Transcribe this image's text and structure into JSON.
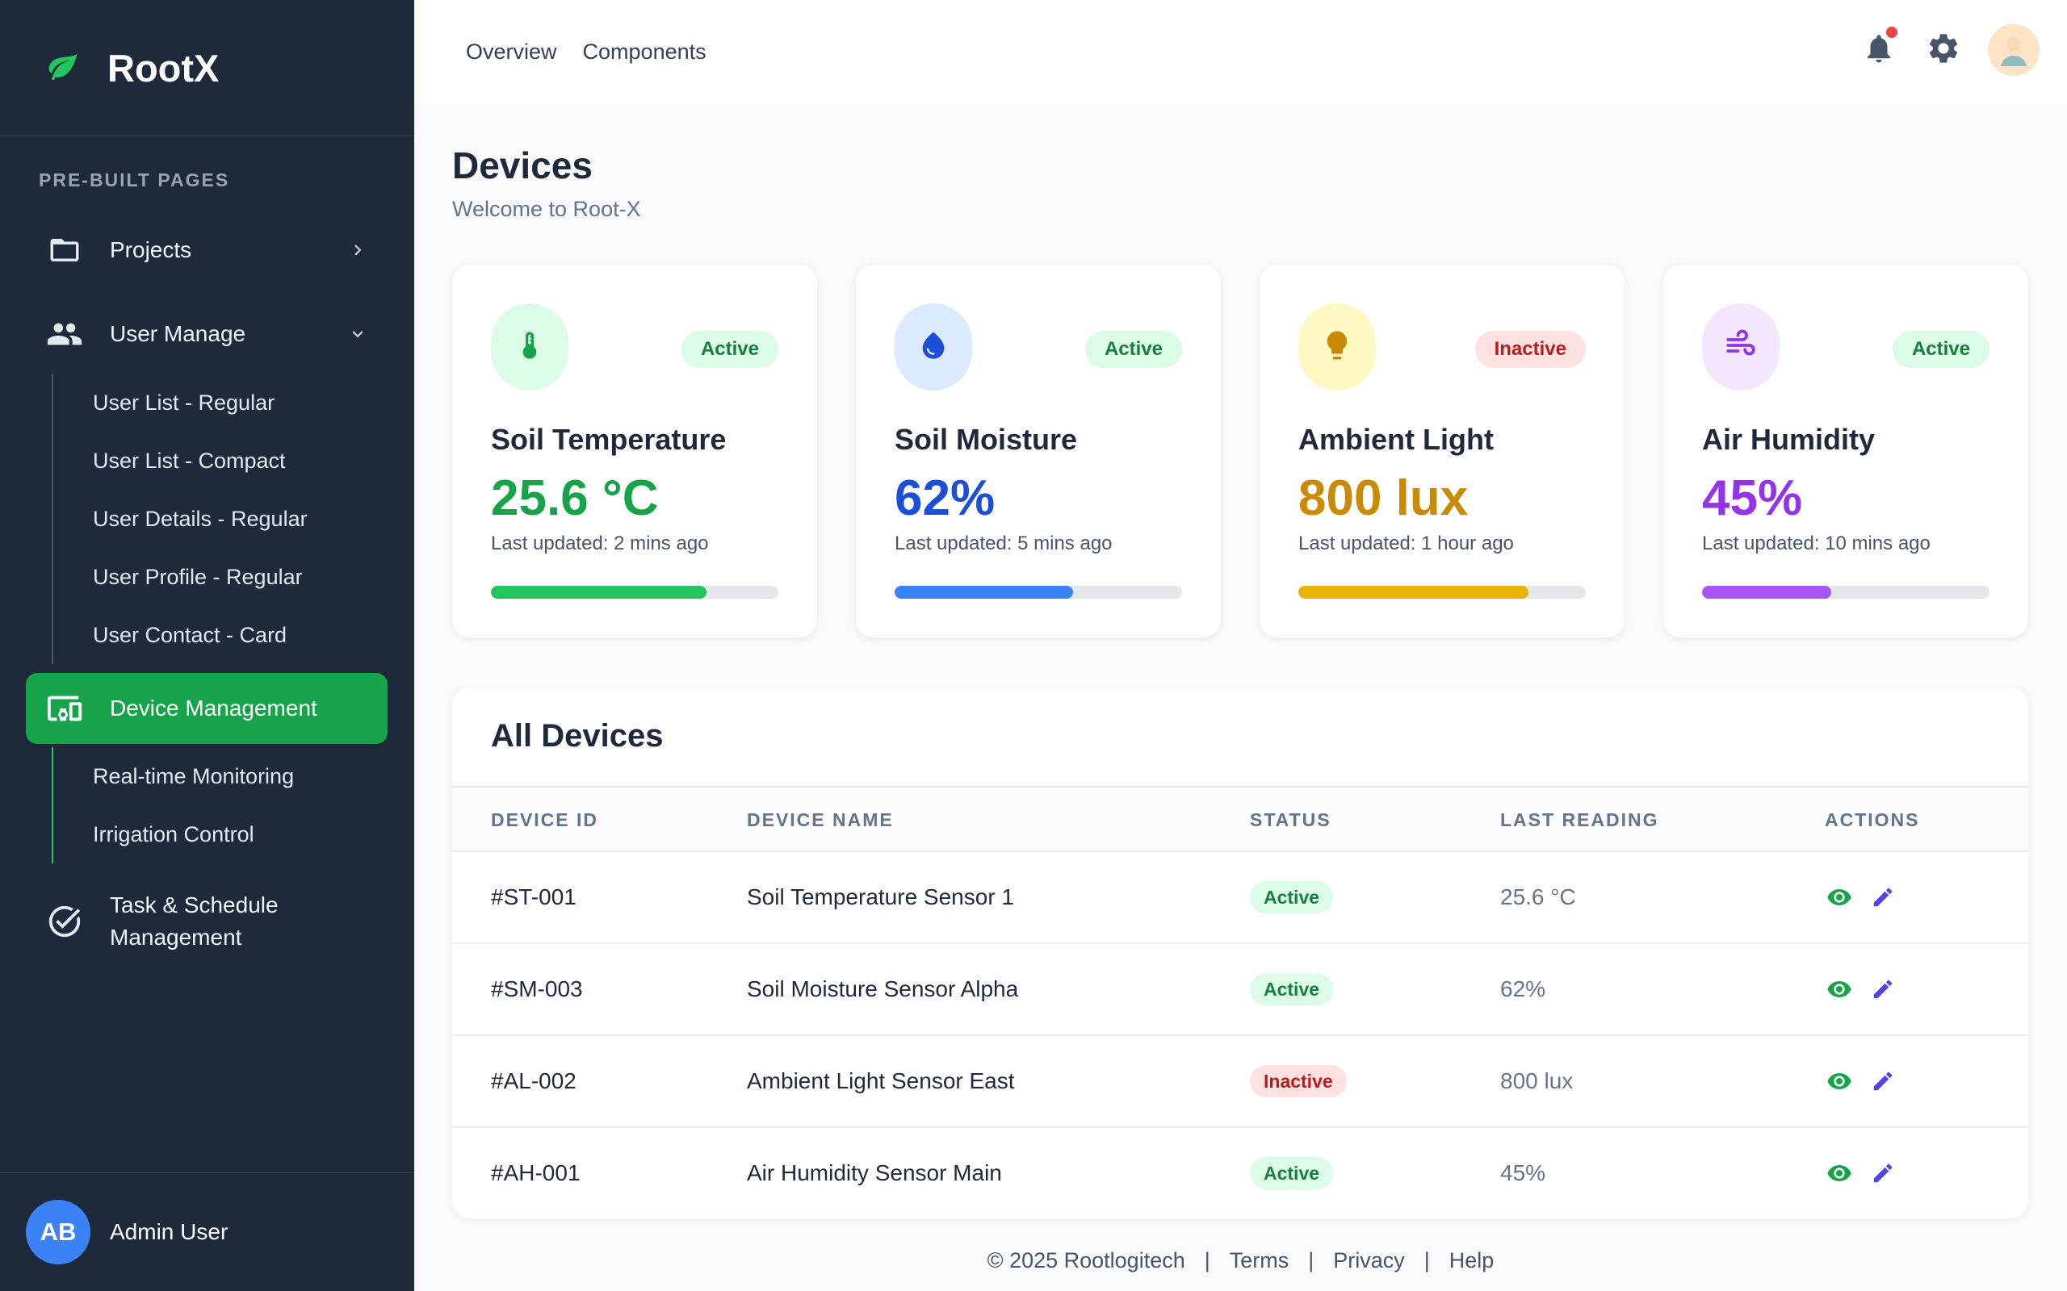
{
  "brand": {
    "name": "RootX"
  },
  "sidebar": {
    "section_label": "PRE-BUILT PAGES",
    "projects_label": "Projects",
    "user_manage_label": "User Manage",
    "user_subitems": [
      "User List - Regular",
      "User List - Compact",
      "User Details - Regular",
      "User Profile - Regular",
      "User Contact - Card"
    ],
    "device_management_label": "Device Management",
    "device_subitems": [
      "Real-time Monitoring",
      "Irrigation Control"
    ],
    "task_label_line1": "Task & Schedule",
    "task_label_line2": "Management",
    "footer": {
      "initials": "AB",
      "name": "Admin User"
    }
  },
  "topbar": {
    "links": [
      "Overview",
      "Components"
    ]
  },
  "page": {
    "title": "Devices",
    "subtitle": "Welcome to Root-X"
  },
  "cards": [
    {
      "title": "Soil Temperature",
      "value": "25.6 °C",
      "updated": "Last updated: 2 mins ago",
      "status": "Active",
      "progress": 0.75,
      "color": "#16a34a",
      "bar_color": "#22c55e",
      "icon_bg": "#dcfce7",
      "icon": "thermometer-icon"
    },
    {
      "title": "Soil Moisture",
      "value": "62%",
      "updated": "Last updated: 5 mins ago",
      "status": "Active",
      "progress": 0.62,
      "color": "#1d4ed8",
      "bar_color": "#3b82f6",
      "icon_bg": "#dbeafe",
      "icon": "water-drop-icon"
    },
    {
      "title": "Ambient Light",
      "value": "800 lux",
      "updated": "Last updated: 1 hour ago",
      "status": "Inactive",
      "progress": 0.8,
      "color": "#ca8a04",
      "bar_color": "#eab308",
      "icon_bg": "#fef9c3",
      "icon": "lightbulb-icon"
    },
    {
      "title": "Air Humidity",
      "value": "45%",
      "updated": "Last updated: 10 mins ago",
      "status": "Active",
      "progress": 0.45,
      "color": "#9333ea",
      "bar_color": "#a855f7",
      "icon_bg": "#f3e8ff",
      "icon": "wind-icon"
    }
  ],
  "table": {
    "title": "All Devices",
    "headers": [
      "DEVICE ID",
      "DEVICE NAME",
      "STATUS",
      "LAST READING",
      "ACTIONS"
    ],
    "rows": [
      {
        "id": "#ST-001",
        "name": "Soil Temperature Sensor 1",
        "status": "Active",
        "reading": "25.6 °C"
      },
      {
        "id": "#SM-003",
        "name": "Soil Moisture Sensor Alpha",
        "status": "Active",
        "reading": "62%"
      },
      {
        "id": "#AL-002",
        "name": "Ambient Light Sensor East",
        "status": "Inactive",
        "reading": "800 lux"
      },
      {
        "id": "#AH-001",
        "name": "Air Humidity Sensor Main",
        "status": "Active",
        "reading": "45%"
      }
    ]
  },
  "footer": {
    "copyright": "© 2025 Rootlogitech",
    "links": [
      "Terms",
      "Privacy",
      "Help"
    ],
    "separator": "|"
  },
  "colors": {
    "sidebar_bg": "#1e293b",
    "accent": "#16a34a",
    "edit_icon": "#4f46e5",
    "view_icon": "#16a34a"
  }
}
